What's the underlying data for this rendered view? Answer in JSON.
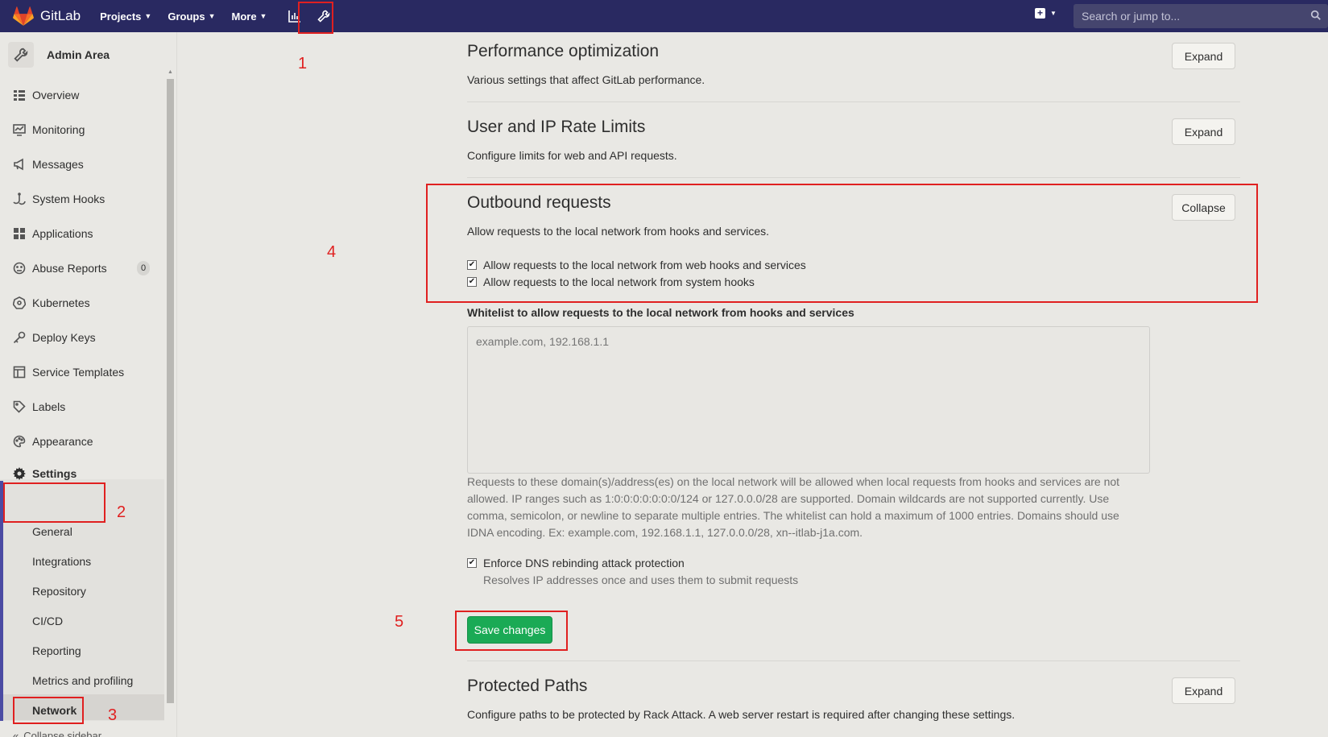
{
  "topbar": {
    "logo_text": "GitLab",
    "nav": [
      {
        "label": "Projects"
      },
      {
        "label": "Groups"
      },
      {
        "label": "More"
      }
    ],
    "search_placeholder": "Search or jump to..."
  },
  "sidebar": {
    "title": "Admin Area",
    "items": [
      {
        "label": "Overview",
        "icon": "overview-icon"
      },
      {
        "label": "Monitoring",
        "icon": "monitor-icon"
      },
      {
        "label": "Messages",
        "icon": "megaphone-icon"
      },
      {
        "label": "System Hooks",
        "icon": "hook-icon"
      },
      {
        "label": "Applications",
        "icon": "grid-icon"
      },
      {
        "label": "Abuse Reports",
        "icon": "smiley-icon",
        "badge": "0"
      },
      {
        "label": "Kubernetes",
        "icon": "kubernetes-icon"
      },
      {
        "label": "Deploy Keys",
        "icon": "key-icon"
      },
      {
        "label": "Service Templates",
        "icon": "template-icon"
      },
      {
        "label": "Labels",
        "icon": "label-icon"
      },
      {
        "label": "Appearance",
        "icon": "palette-icon"
      },
      {
        "label": "Settings",
        "icon": "gear-icon"
      }
    ],
    "settings_sub": [
      "General",
      "Integrations",
      "Repository",
      "CI/CD",
      "Reporting",
      "Metrics and profiling",
      "Network"
    ],
    "collapse_label": "Collapse sidebar"
  },
  "annotations": [
    "1",
    "2",
    "3",
    "4",
    "5"
  ],
  "content": {
    "sections": [
      {
        "title": "Performance optimization",
        "desc": "Various settings that affect GitLab performance.",
        "button": "Expand"
      },
      {
        "title": "User and IP Rate Limits",
        "desc": "Configure limits for web and API requests.",
        "button": "Expand"
      },
      {
        "title": "Outbound requests",
        "desc": "Allow requests to the local network from hooks and services.",
        "button": "Collapse"
      },
      {
        "title": "Protected Paths",
        "desc": "Configure paths to be protected by Rack Attack. A web server restart is required after changing these settings.",
        "button": "Expand"
      }
    ],
    "checkbox_webhooks": "Allow requests to the local network from web hooks and services",
    "checkbox_systemhooks": "Allow requests to the local network from system hooks",
    "whitelist_label": "Whitelist to allow requests to the local network from hooks and services",
    "whitelist_placeholder": "example.com, 192.168.1.1",
    "whitelist_help": "Requests to these domain(s)/address(es) on the local network will be allowed when local requests from hooks and services are not allowed. IP ranges such as 1:0:0:0:0:0:0:0/124 or 127.0.0.0/28 are supported. Domain wildcards are not supported currently. Use comma, semicolon, or newline to separate multiple entries. The whitelist can hold a maximum of 1000 entries. Domains should use IDNA encoding. Ex: example.com, 192.168.1.1, 127.0.0.0/28, xn--itlab-j1a.com.",
    "dns_label": "Enforce DNS rebinding attack protection",
    "dns_help": "Resolves IP addresses once and uses them to submit requests",
    "save_label": "Save changes"
  },
  "colors": {
    "nav_bg": "#292961",
    "save_green": "#1aaa55",
    "annotation_red": "#e02020"
  }
}
